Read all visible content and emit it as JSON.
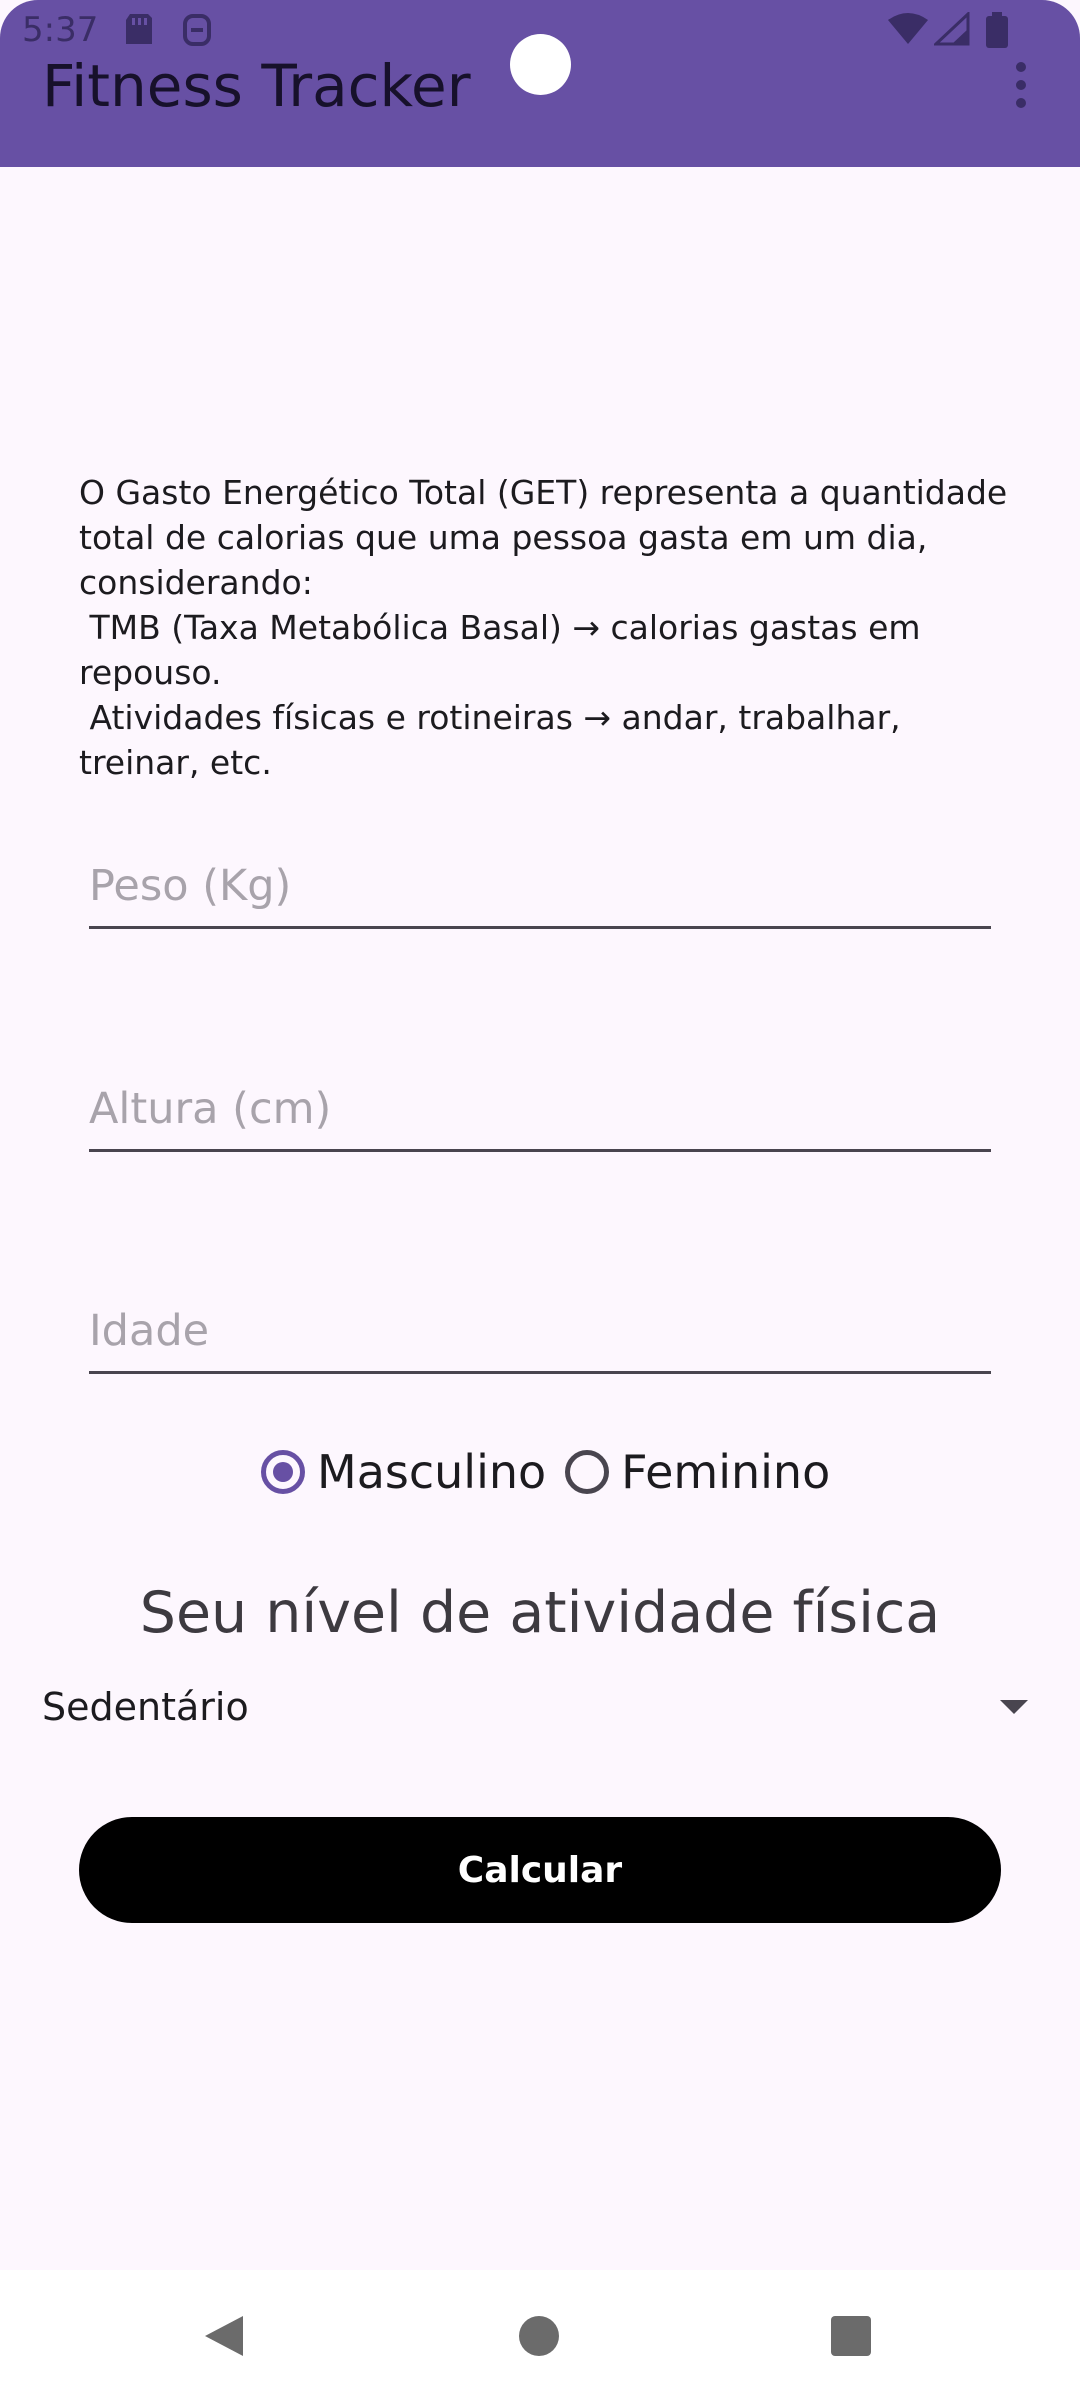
{
  "status_bar": {
    "time": "5:37",
    "icons": [
      "sd-card-icon",
      "notification-icon",
      "wifi-icon",
      "signal-icon",
      "battery-icon"
    ]
  },
  "app_bar": {
    "title": "Fitness Tracker",
    "menu_icon": "more-vert-icon"
  },
  "main": {
    "description": "O Gasto Energético Total (GET) representa a quantidade total de calorias que uma pessoa gasta em um dia, considerando:\n TMB (Taxa Metabólica Basal) → calorias gastas em repouso.\n Atividades físicas e rotineiras → andar, trabalhar, treinar, etc.",
    "fields": {
      "weight": {
        "value": "",
        "placeholder": "Peso (Kg)"
      },
      "height": {
        "value": "",
        "placeholder": "Altura (cm)"
      },
      "age": {
        "value": "",
        "placeholder": "Idade"
      }
    },
    "gender": {
      "options": [
        "Masculino",
        "Feminino"
      ],
      "selected": "Masculino"
    },
    "activity": {
      "heading": "Seu nível de atividade física",
      "selected": "Sedentário"
    },
    "calculate_button": "Calcular"
  },
  "nav_bar": {
    "icons": [
      "back-icon",
      "home-icon",
      "recents-icon"
    ]
  },
  "colors": {
    "primary": "#6750A4",
    "background": "#FDF7FE",
    "button": "#000000"
  }
}
